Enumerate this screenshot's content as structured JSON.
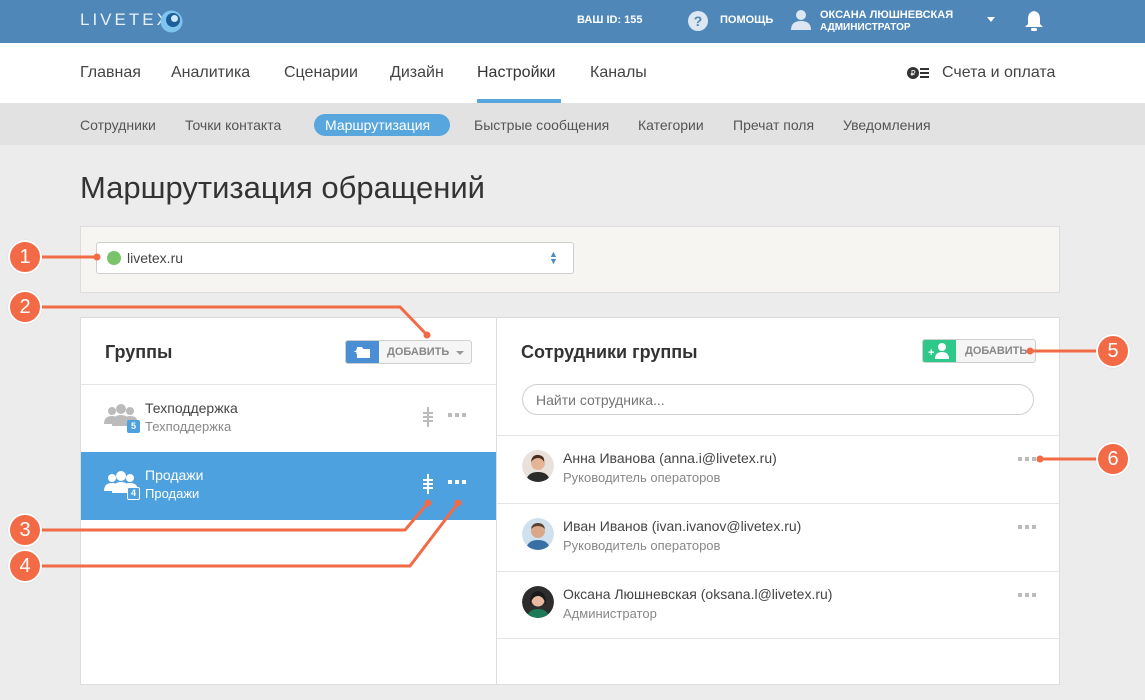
{
  "topbar": {
    "logo": "LIVETEX",
    "user_id": "ВАШ ID: 155",
    "help": "ПОМОЩЬ",
    "user_name": "ОКСАНА ЛЮШНЕВСКАЯ",
    "user_role": "АДМИНИСТРАТОР"
  },
  "main_nav": {
    "items": [
      "Главная",
      "Аналитика",
      "Сценарии",
      "Дизайн",
      "Настройки",
      "Каналы"
    ],
    "billing": "Счета и оплата"
  },
  "sub_nav": {
    "items": [
      "Сотрудники",
      "Точки контакта",
      "Маршрутизация",
      "Быстрые сообщения",
      "Категории",
      "Пречат поля",
      "Уведомления"
    ]
  },
  "page_title": "Маршрутизация обращений",
  "site_select": {
    "value": "livetex.ru"
  },
  "groups": {
    "title": "Группы",
    "add_label": "ДОБАВИТЬ",
    "items": [
      {
        "name": "Техподдержка",
        "sub": "Техподдержка",
        "count": "5"
      },
      {
        "name": "Продажи",
        "sub": "Продажи",
        "count": "4"
      }
    ]
  },
  "members": {
    "title": "Сотрудники группы",
    "add_label": "ДОБАВИТЬ",
    "search_placeholder": "Найти сотрудника...",
    "items": [
      {
        "name": "Анна Иванова (anna.i@livetex.ru)",
        "role": "Руководитель операторов"
      },
      {
        "name": "Иван Иванов (ivan.ivanov@livetex.ru)",
        "role": "Руководитель операторов"
      },
      {
        "name": "Оксана Люшневская (oksana.l@livetex.ru)",
        "role": "Администратор"
      }
    ]
  },
  "callouts": [
    "1",
    "2",
    "3",
    "4",
    "5",
    "6"
  ],
  "colors": {
    "header": "#4e87b8",
    "accent": "#58a6de",
    "active_row": "#4ea1df",
    "callout": "#f26b46",
    "add_member": "#2ec88a"
  },
  "icons": [
    "logo-icon",
    "help-icon",
    "user-icon",
    "bell-icon",
    "billing-icon",
    "globe-icon",
    "add-folder-icon",
    "add-user-icon",
    "group-icon",
    "sort-icon",
    "more-icon"
  ]
}
